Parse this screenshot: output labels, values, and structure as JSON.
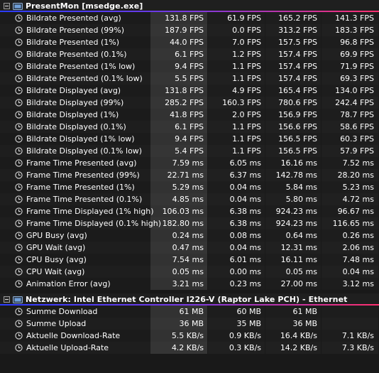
{
  "sections": [
    {
      "title": "PresentMon [msedge.exe]",
      "rows": [
        {
          "label": "Bildrate Presented (avg)",
          "v": [
            "131.8 FPS",
            "61.9 FPS",
            "165.2 FPS",
            "141.3 FPS"
          ]
        },
        {
          "label": "Bildrate Presented (99%)",
          "v": [
            "187.9 FPS",
            "0.0 FPS",
            "313.2 FPS",
            "183.3 FPS"
          ]
        },
        {
          "label": "Bildrate Presented (1%)",
          "v": [
            "44.0 FPS",
            "7.0 FPS",
            "157.5 FPS",
            "96.8 FPS"
          ]
        },
        {
          "label": "Bildrate Presented (0.1%)",
          "v": [
            "6.1 FPS",
            "1.2 FPS",
            "157.4 FPS",
            "69.9 FPS"
          ]
        },
        {
          "label": "Bildrate Presented (1% low)",
          "v": [
            "9.4 FPS",
            "1.1 FPS",
            "157.4 FPS",
            "71.9 FPS"
          ]
        },
        {
          "label": "Bildrate Presented (0.1% low)",
          "v": [
            "5.5 FPS",
            "1.1 FPS",
            "157.4 FPS",
            "69.3 FPS"
          ]
        },
        {
          "label": "Bildrate Displayed (avg)",
          "v": [
            "131.8 FPS",
            "4.9 FPS",
            "165.4 FPS",
            "134.0 FPS"
          ]
        },
        {
          "label": "Bildrate Displayed (99%)",
          "v": [
            "285.2 FPS",
            "160.3 FPS",
            "780.6 FPS",
            "242.4 FPS"
          ]
        },
        {
          "label": "Bildrate Displayed (1%)",
          "v": [
            "41.8 FPS",
            "2.0 FPS",
            "156.9 FPS",
            "78.7 FPS"
          ]
        },
        {
          "label": "Bildrate Displayed (0.1%)",
          "v": [
            "6.1 FPS",
            "1.1 FPS",
            "156.6 FPS",
            "58.6 FPS"
          ]
        },
        {
          "label": "Bildrate Displayed (1% low)",
          "v": [
            "9.4 FPS",
            "1.1 FPS",
            "156.5 FPS",
            "60.3 FPS"
          ]
        },
        {
          "label": "Bildrate Displayed (0.1% low)",
          "v": [
            "5.4 FPS",
            "1.1 FPS",
            "156.5 FPS",
            "57.9 FPS"
          ]
        },
        {
          "label": "Frame Time Presented (avg)",
          "v": [
            "7.59 ms",
            "6.05 ms",
            "16.16 ms",
            "7.52 ms"
          ]
        },
        {
          "label": "Frame Time Presented (99%)",
          "v": [
            "22.71 ms",
            "6.37 ms",
            "142.78 ms",
            "28.20 ms"
          ]
        },
        {
          "label": "Frame Time Presented (1%)",
          "v": [
            "5.29 ms",
            "0.04 ms",
            "5.84 ms",
            "5.23 ms"
          ]
        },
        {
          "label": "Frame Time Presented (0.1%)",
          "v": [
            "4.85 ms",
            "0.04 ms",
            "5.80 ms",
            "4.72 ms"
          ]
        },
        {
          "label": "Frame Time Displayed (1% high)",
          "v": [
            "106.03 ms",
            "6.38 ms",
            "924.23 ms",
            "96.67 ms"
          ]
        },
        {
          "label": "Frame Time Displayed (0.1% high)",
          "v": [
            "182.80 ms",
            "6.38 ms",
            "924.23 ms",
            "116.65 ms"
          ]
        },
        {
          "label": "GPU Busy (avg)",
          "v": [
            "0.24 ms",
            "0.08 ms",
            "0.64 ms",
            "0.26 ms"
          ]
        },
        {
          "label": "GPU Wait (avg)",
          "v": [
            "0.47 ms",
            "0.04 ms",
            "12.31 ms",
            "2.06 ms"
          ]
        },
        {
          "label": "CPU Busy (avg)",
          "v": [
            "7.54 ms",
            "6.01 ms",
            "16.11 ms",
            "7.48 ms"
          ]
        },
        {
          "label": "CPU Wait (avg)",
          "v": [
            "0.05 ms",
            "0.00 ms",
            "0.05 ms",
            "0.04 ms"
          ]
        },
        {
          "label": "Animation Error (avg)",
          "v": [
            "3.21 ms",
            "0.23 ms",
            "27.00 ms",
            "3.12 ms"
          ]
        }
      ]
    },
    {
      "title": "Netzwerk: Intel Ethernet Controller I226-V (Raptor Lake PCH) - Ethernet",
      "rows": [
        {
          "label": "Summe Download",
          "v": [
            "61 MB",
            "60 MB",
            "61 MB",
            ""
          ]
        },
        {
          "label": "Summe Upload",
          "v": [
            "36 MB",
            "35 MB",
            "36 MB",
            ""
          ]
        },
        {
          "label": "Aktuelle Download-Rate",
          "v": [
            "5.5 KB/s",
            "0.9 KB/s",
            "16.4 KB/s",
            "7.1 KB/s"
          ]
        },
        {
          "label": "Aktuelle Upload-Rate",
          "v": [
            "4.2 KB/s",
            "0.3 KB/s",
            "14.2 KB/s",
            "7.3 KB/s"
          ]
        }
      ]
    }
  ],
  "icons": {
    "expander": "expander-minus-icon",
    "group": "sensor-group-icon",
    "row": "clock-icon"
  }
}
